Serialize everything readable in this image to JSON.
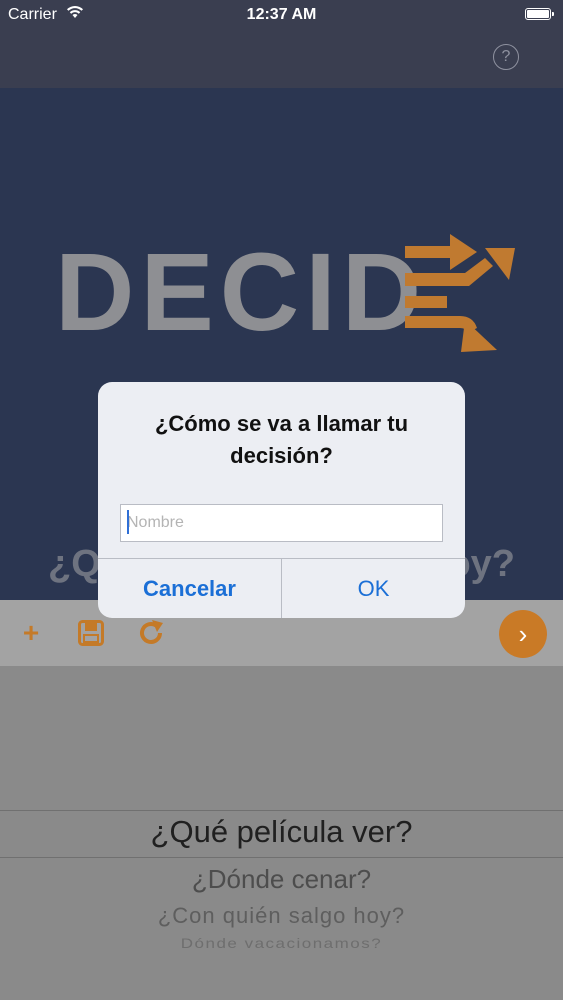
{
  "status_bar": {
    "carrier": "Carrier",
    "time": "12:37 AM"
  },
  "nav": {
    "help_label": "?"
  },
  "hero": {
    "logo_text": "DECID",
    "question_start": "¿Q",
    "question_end": "oy?"
  },
  "toolbar": {
    "add_label": "+",
    "next_label": "›"
  },
  "picker": {
    "selected": "¿Qué película ver?",
    "items": [
      "¿Dónde cenar?",
      "¿Con quién salgo hoy?",
      "Dónde vacacionamos?"
    ]
  },
  "alert": {
    "title": "¿Cómo se va a llamar tu decisión?",
    "input_placeholder": "Nombre",
    "cancel_label": "Cancelar",
    "ok_label": "OK"
  },
  "colors": {
    "accent": "#c97a26",
    "hero_bg": "#2b3651",
    "link": "#1b6fd6"
  }
}
